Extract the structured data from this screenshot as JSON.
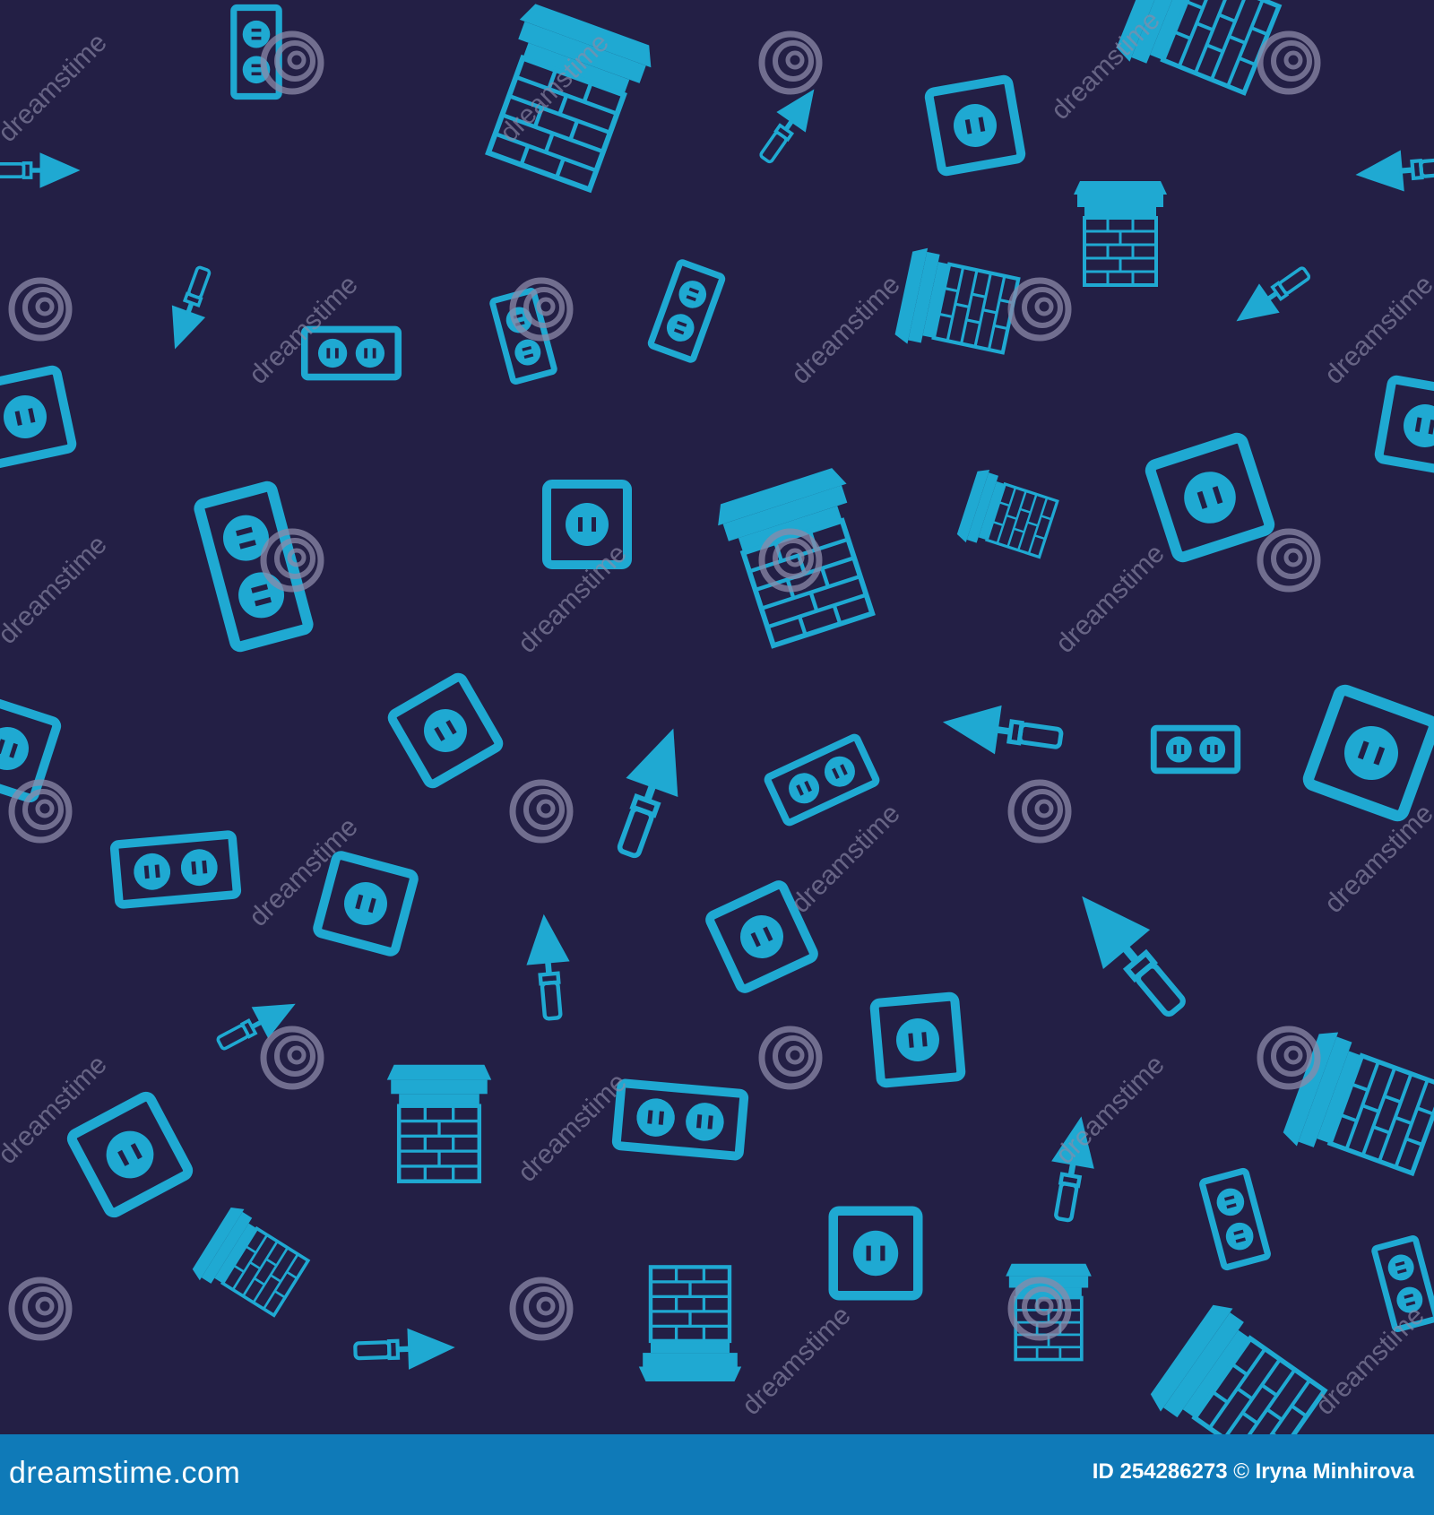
{
  "colors": {
    "background": "#231f45",
    "icon": "#1fa9d2",
    "watermark": "#8c8aa8",
    "footer": "#0f7ab8",
    "footer_text": "#ffffff"
  },
  "watermark": {
    "text": "dreamstime",
    "logo_icon": "swirl-icon"
  },
  "icon_kinds": [
    "electrical-outlet-icon",
    "double-outlet-icon",
    "trowel-icon",
    "chimney-icon"
  ],
  "footer": {
    "site": "dreamstime.com",
    "id_label": "ID 254286273",
    "copyright": "©",
    "author": "Iryna Minhirova"
  }
}
